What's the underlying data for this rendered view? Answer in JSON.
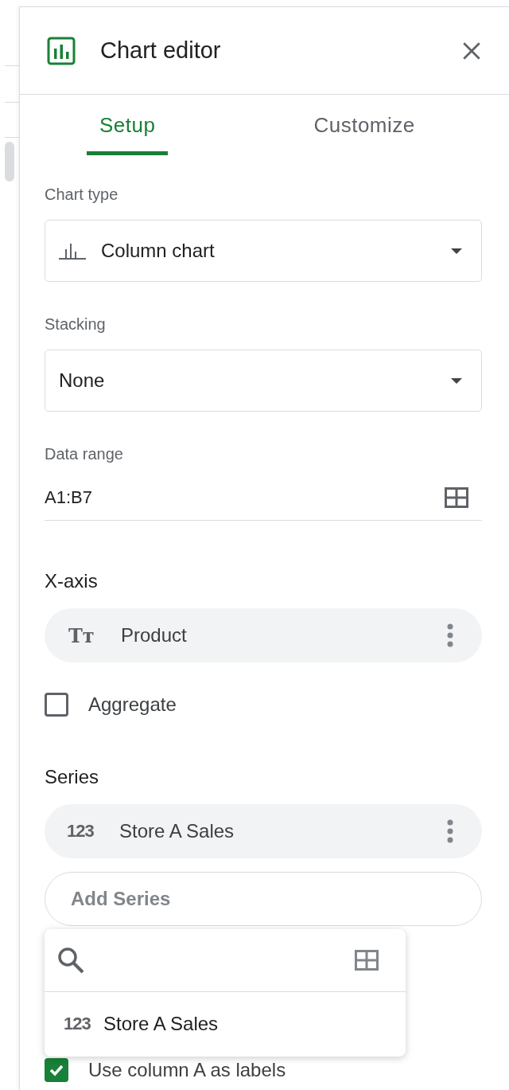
{
  "header": {
    "title": "Chart editor"
  },
  "tabs": [
    {
      "label": "Setup",
      "selected": true
    },
    {
      "label": "Customize",
      "selected": false
    }
  ],
  "chart_type": {
    "label": "Chart type",
    "value": "Column chart"
  },
  "stacking": {
    "label": "Stacking",
    "value": "None"
  },
  "data_range": {
    "label": "Data range",
    "value": "A1:B7"
  },
  "x_axis": {
    "heading": "X-axis",
    "chip": {
      "glyph": "Tт",
      "label": "Product"
    },
    "aggregate": {
      "label": "Aggregate",
      "checked": false
    }
  },
  "series": {
    "heading": "Series",
    "chips": [
      {
        "glyph": "123",
        "label": "Store A Sales"
      }
    ],
    "add_placeholder": "Add Series"
  },
  "popup": {
    "items": [
      {
        "glyph": "123",
        "label": "Store A Sales"
      }
    ]
  },
  "use_labels": {
    "label": "Use column A as labels",
    "checked": true
  }
}
